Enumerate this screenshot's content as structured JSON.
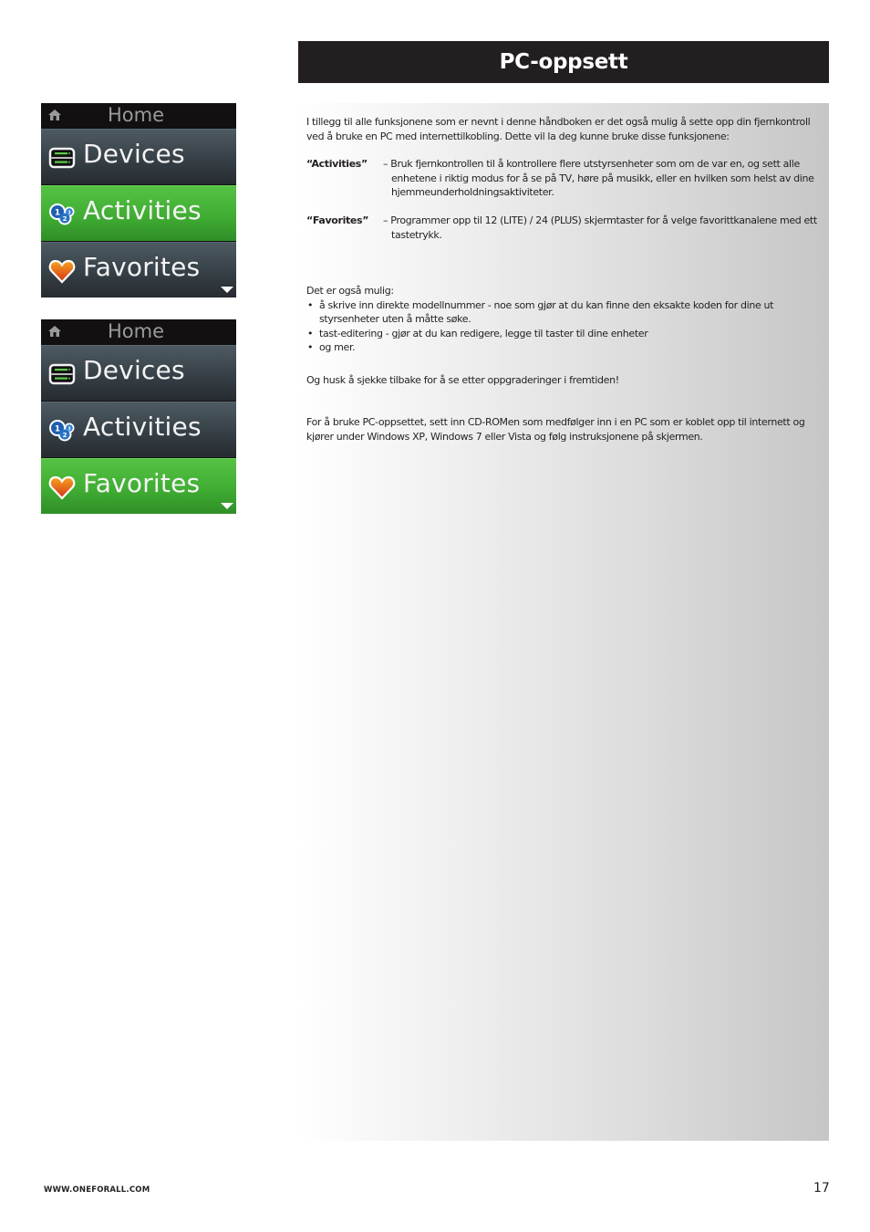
{
  "title": "PC-oppsett",
  "intro": "I tillegg til alle funksjonene som er nevnt i denne håndboken er det også mulig å sette opp din fjernkontroll ved å bruke en PC med internettilkobling.  Dette vil la deg kunne bruke disse funksjonene:",
  "definitions": [
    {
      "term": "“Activities”",
      "description": "– Bruk fjernkontrollen til å kontrollere flere utstyrsenheter som om de var en, og sett alle enhetene i riktig modus for å se på TV, høre på musikk, eller en hvilken som helst av dine hjemmeunderholdningsaktiviteter."
    },
    {
      "term": "“Favorites”",
      "description": "– Programmer opp til 12 (LITE) / 24 (PLUS) skjermtaster for å velge favorittkanalene med ett tastetrykk."
    }
  ],
  "also_possible": {
    "heading": "Det er også mulig:",
    "bullet_char": "•",
    "items": [
      "å skrive inn direkte modellnummer - noe som gjør at du kan finne den eksakte koden for dine ut styrsenheter uten å måtte søke.",
      "tast-editering - gjør at du kan redigere, legge til taster til dine enheter",
      "og mer."
    ]
  },
  "reminder": "Og husk å sjekke tilbake for å se etter oppgraderinger i fremtiden!",
  "instructions": "For å bruke PC-oppsettet, sett inn CD-ROMen som medfølger inn i en PC som er koblet opp til internett og kjører under Windows XP, Windows 7 eller Vista og følg instruksjonene på skjermen.",
  "screens": [
    {
      "header": "Home",
      "items": [
        {
          "label": "Devices",
          "icon": "devices-icon",
          "active": false
        },
        {
          "label": "Activities",
          "icon": "activities-icon",
          "active": true
        },
        {
          "label": "Favorites",
          "icon": "favorites-icon",
          "active": false
        }
      ]
    },
    {
      "header": "Home",
      "items": [
        {
          "label": "Devices",
          "icon": "devices-icon",
          "active": false
        },
        {
          "label": "Activities",
          "icon": "activities-icon",
          "active": false
        },
        {
          "label": "Favorites",
          "icon": "favorites-icon",
          "active": true
        }
      ]
    }
  ],
  "colors": {
    "title_bg": "#231f20",
    "active_green": "#40ad33",
    "inactive_gray": "#3a444b"
  },
  "footer": {
    "url": "WWW.ONEFORALL.COM",
    "page_number": "17"
  }
}
